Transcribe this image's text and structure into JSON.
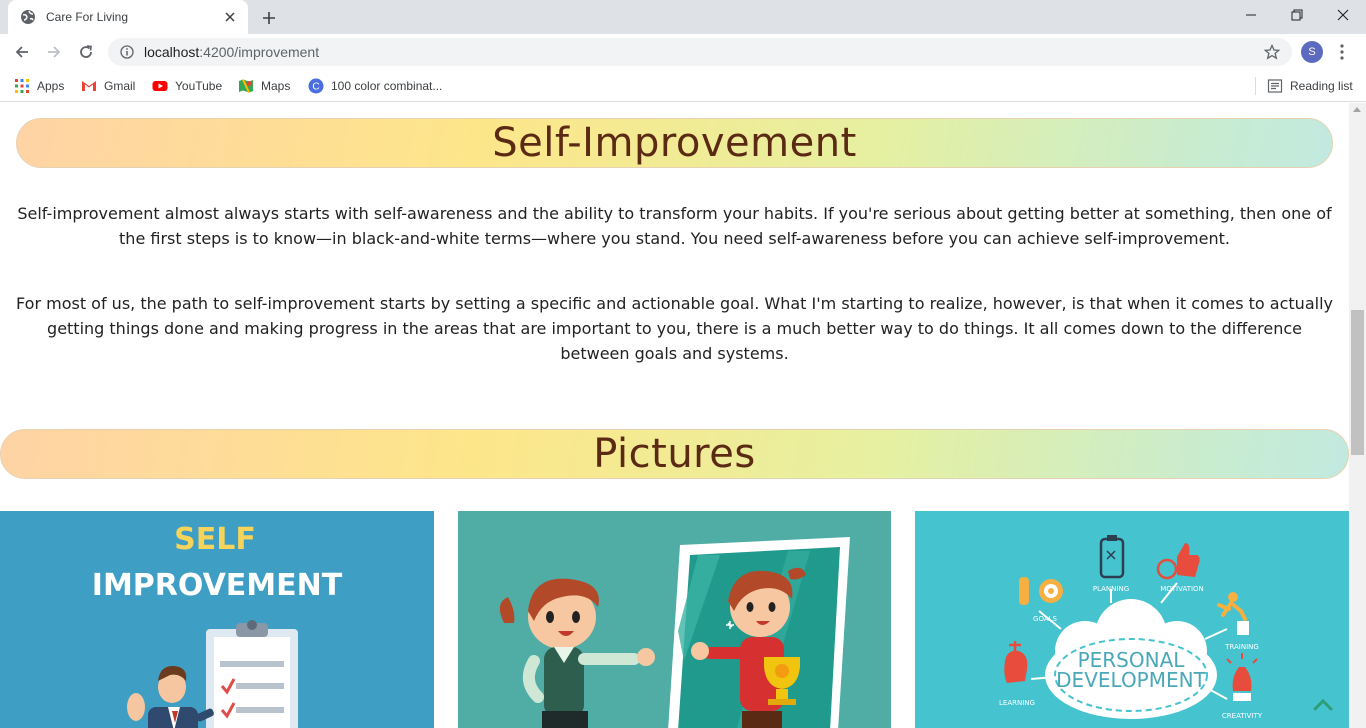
{
  "browser": {
    "tab_title": "Care For Living",
    "url_host": "localhost",
    "url_path": ":4200/improvement",
    "profile_initial": "S",
    "bookmarks": [
      {
        "label": "Apps",
        "icon": "apps-grid-icon"
      },
      {
        "label": "Gmail",
        "icon": "gmail-icon"
      },
      {
        "label": "YouTube",
        "icon": "youtube-icon"
      },
      {
        "label": "Maps",
        "icon": "maps-icon"
      },
      {
        "label": "100 color combinat...",
        "icon": "color-site-icon"
      }
    ],
    "reading_list": "Reading list"
  },
  "page": {
    "heading": "Self-Improvement",
    "paragraph_1": "Self-improvement almost always starts with self-awareness and the ability to transform your habits. If you're serious about getting better at something, then one of the first steps is to know—in black-and-white terms—where you stand. You need self-awareness before you can achieve self-improvement.",
    "paragraph_2": "For most of us, the path to self-improvement starts by setting a specific and actionable goal. What I'm starting to realize, however, is that when it comes to actually getting things done and making progress in the areas that are important to you, there is a much better way to do things. It all comes down to the difference between goals and systems.",
    "pictures_heading": "Pictures",
    "picture_1": {
      "title_line1": "SELF",
      "title_line2": "IMPROVEMENT"
    },
    "picture_3": {
      "center_line1": "PERSONAL",
      "center_line2": "DEVELOPMENT",
      "labels": [
        "GOALS",
        "PLANNING",
        "MOTIVATION",
        "TRAINING",
        "LEARNING",
        "CREATIVITY"
      ]
    }
  },
  "colors": {
    "heading_text": "#5a2a14",
    "pic1_bg": "#3f9ec4",
    "pic2_bg": "#4fada6",
    "pic3_bg": "#45c3cf",
    "scroll_top_arrow": "#2e9e78"
  }
}
